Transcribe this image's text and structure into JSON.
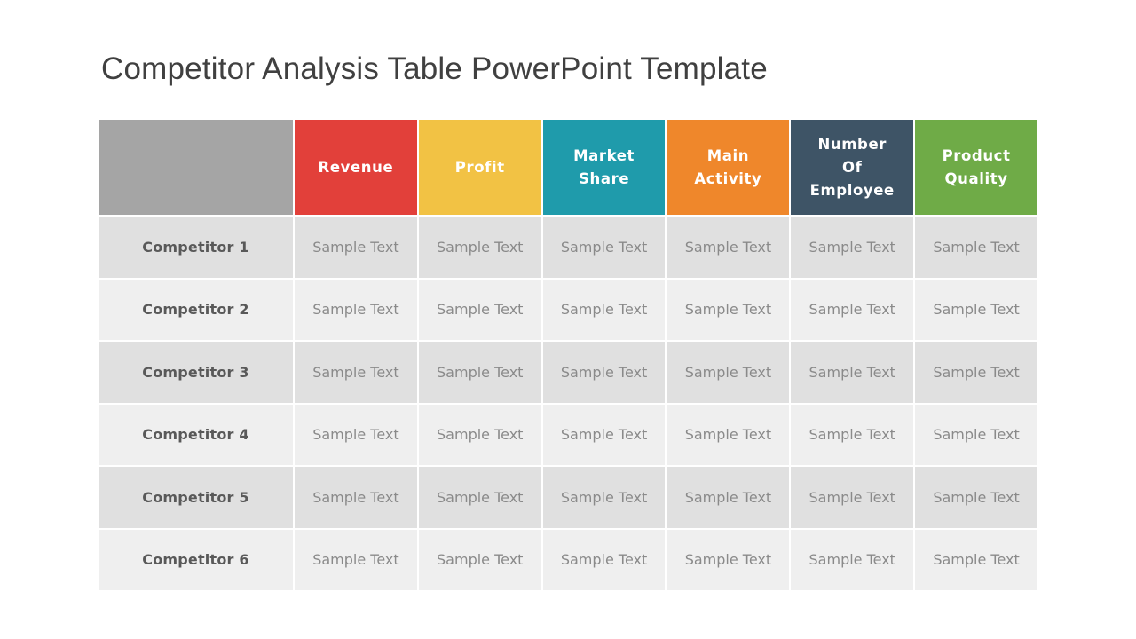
{
  "title": "Competitor Analysis Table PowerPoint Template",
  "table": {
    "corner_color": "#a5a5a5",
    "columns": [
      {
        "label": "Revenue",
        "color": "#e2403a"
      },
      {
        "label": "Profit",
        "color": "#f2c244"
      },
      {
        "label": "Market Share",
        "color": "#1f9bab"
      },
      {
        "label": "Main Activity",
        "color": "#ef872b"
      },
      {
        "label": "Number Of Employee",
        "color": "#3e5466"
      },
      {
        "label": "Product Quality",
        "color": "#6fab47"
      }
    ],
    "rows": [
      {
        "label": "Competitor 1",
        "cells": [
          "Sample Text",
          "Sample Text",
          "Sample Text",
          "Sample Text",
          "Sample Text",
          "Sample Text"
        ]
      },
      {
        "label": "Competitor 2",
        "cells": [
          "Sample Text",
          "Sample Text",
          "Sample Text",
          "Sample Text",
          "Sample Text",
          "Sample Text"
        ]
      },
      {
        "label": "Competitor 3",
        "cells": [
          "Sample Text",
          "Sample Text",
          "Sample Text",
          "Sample Text",
          "Sample Text",
          "Sample Text"
        ]
      },
      {
        "label": "Competitor 4",
        "cells": [
          "Sample Text",
          "Sample Text",
          "Sample Text",
          "Sample Text",
          "Sample Text",
          "Sample Text"
        ]
      },
      {
        "label": "Competitor 5",
        "cells": [
          "Sample Text",
          "Sample Text",
          "Sample Text",
          "Sample Text",
          "Sample Text",
          "Sample Text"
        ]
      },
      {
        "label": "Competitor 6",
        "cells": [
          "Sample Text",
          "Sample Text",
          "Sample Text",
          "Sample Text",
          "Sample Text",
          "Sample Text"
        ]
      }
    ]
  }
}
